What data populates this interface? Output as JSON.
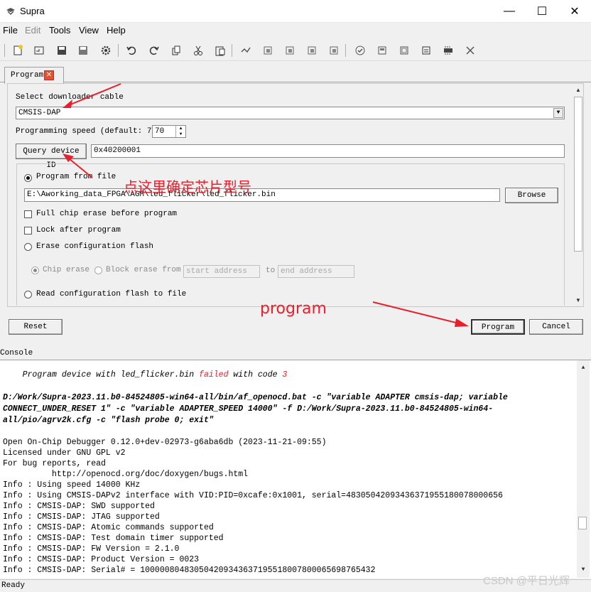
{
  "window": {
    "title": "Supra",
    "minimize": "—",
    "maximize": "☐",
    "close": "✕"
  },
  "menu": [
    "File",
    "Edit",
    "Tools",
    "View",
    "Help"
  ],
  "toolbar_icons": [
    "new-file",
    "open",
    "save",
    "save-as",
    "settings",
    "undo",
    "redo",
    "copy",
    "cut",
    "paste",
    "tool-a",
    "tool-b",
    "tool-c",
    "tool-d",
    "tool-e",
    "check",
    "tool-f",
    "tool-g",
    "tool-h",
    "tool-i",
    "stop"
  ],
  "tab": {
    "label": "Program",
    "close": "✕"
  },
  "program": {
    "cable_label": "Select downloader cable",
    "cable_value": "CMSIS-DAP",
    "speed_label": "Programming speed (default: 70)",
    "speed_value": "70",
    "query_button": "Query device ID",
    "device_id": "0x40200001",
    "program_from_file": "Program from file",
    "file_path": "E:\\Aworking_data_FPGA\\AGM\\led_flicker\\led_flicker.bin",
    "browse_button": "Browse",
    "full_chip_erase": "Full chip erase before program",
    "lock_after": "Lock after program",
    "erase_config": "Erase configuration flash",
    "chip_erase": "Chip erase",
    "block_erase": "Block erase from",
    "start_address": "start address",
    "to_label": "to",
    "end_address": "end address",
    "read_config": "Read configuration flash to file"
  },
  "buttons": {
    "reset": "Reset",
    "program": "Program",
    "cancel": "Cancel"
  },
  "annotations": {
    "chinese_note": "点这里确定芯片型号",
    "program_note": "program"
  },
  "console": {
    "label": "Console",
    "first_line": {
      "prefix": "Program device with led_flicker.bin ",
      "failed": "failed",
      "middle": " with code ",
      "code": "3"
    },
    "command_lines": [
      "D:/Work/Supra-2023.11.b0-84524805-win64-all/bin/af_openocd.bat -c \"variable ADAPTER cmsis-dap; variable",
      "CONNECT_UNDER_RESET 1\" -c \"variable ADAPTER_SPEED 14000\" -f D:/Work/Supra-2023.11.b0-84524805-win64-",
      "all/pio/agrv2k.cfg -c \"flash probe 0; exit\""
    ],
    "output_lines": [
      "Open On-Chip Debugger 0.12.0+dev-02973-g6aba6db (2023-11-21-09:55)",
      "Licensed under GNU GPL v2",
      "For bug reports, read",
      "          http://openocd.org/doc/doxygen/bugs.html",
      "Info : Using speed 14000 KHz",
      "Info : Using CMSIS-DAPv2 interface with VID:PID=0xcafe:0x1001, serial=48305042093436371955180078000656",
      "Info : CMSIS-DAP: SWD supported",
      "Info : CMSIS-DAP: JTAG supported",
      "Info : CMSIS-DAP: Atomic commands supported",
      "Info : CMSIS-DAP: Test domain timer supported",
      "Info : CMSIS-DAP: FW Version = 2.1.0",
      "Info : CMSIS-DAP: Product Version = 0023",
      "Info : CMSIS-DAP: Serial# = 10000080483050420934363719551800780006569876543​2"
    ]
  },
  "status": "Ready",
  "watermark": "CSDN @平日光辉",
  "colors": {
    "failed": "#e8202c",
    "annotation": "#e8202c"
  }
}
